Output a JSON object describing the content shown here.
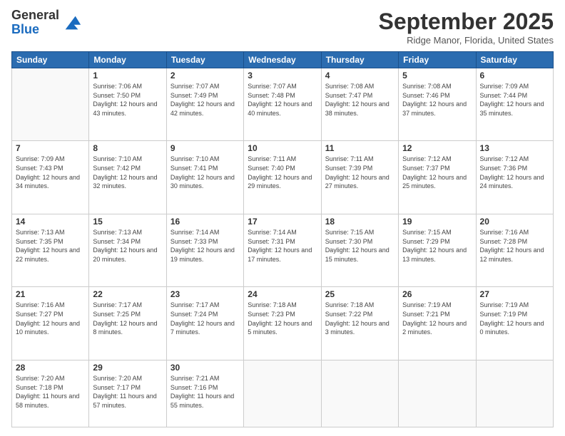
{
  "header": {
    "logo_general": "General",
    "logo_blue": "Blue",
    "month_title": "September 2025",
    "location": "Ridge Manor, Florida, United States"
  },
  "weekdays": [
    "Sunday",
    "Monday",
    "Tuesday",
    "Wednesday",
    "Thursday",
    "Friday",
    "Saturday"
  ],
  "weeks": [
    [
      {
        "day": "",
        "info": ""
      },
      {
        "day": "1",
        "info": "Sunrise: 7:06 AM\nSunset: 7:50 PM\nDaylight: 12 hours\nand 43 minutes."
      },
      {
        "day": "2",
        "info": "Sunrise: 7:07 AM\nSunset: 7:49 PM\nDaylight: 12 hours\nand 42 minutes."
      },
      {
        "day": "3",
        "info": "Sunrise: 7:07 AM\nSunset: 7:48 PM\nDaylight: 12 hours\nand 40 minutes."
      },
      {
        "day": "4",
        "info": "Sunrise: 7:08 AM\nSunset: 7:47 PM\nDaylight: 12 hours\nand 38 minutes."
      },
      {
        "day": "5",
        "info": "Sunrise: 7:08 AM\nSunset: 7:46 PM\nDaylight: 12 hours\nand 37 minutes."
      },
      {
        "day": "6",
        "info": "Sunrise: 7:09 AM\nSunset: 7:44 PM\nDaylight: 12 hours\nand 35 minutes."
      }
    ],
    [
      {
        "day": "7",
        "info": "Sunrise: 7:09 AM\nSunset: 7:43 PM\nDaylight: 12 hours\nand 34 minutes."
      },
      {
        "day": "8",
        "info": "Sunrise: 7:10 AM\nSunset: 7:42 PM\nDaylight: 12 hours\nand 32 minutes."
      },
      {
        "day": "9",
        "info": "Sunrise: 7:10 AM\nSunset: 7:41 PM\nDaylight: 12 hours\nand 30 minutes."
      },
      {
        "day": "10",
        "info": "Sunrise: 7:11 AM\nSunset: 7:40 PM\nDaylight: 12 hours\nand 29 minutes."
      },
      {
        "day": "11",
        "info": "Sunrise: 7:11 AM\nSunset: 7:39 PM\nDaylight: 12 hours\nand 27 minutes."
      },
      {
        "day": "12",
        "info": "Sunrise: 7:12 AM\nSunset: 7:37 PM\nDaylight: 12 hours\nand 25 minutes."
      },
      {
        "day": "13",
        "info": "Sunrise: 7:12 AM\nSunset: 7:36 PM\nDaylight: 12 hours\nand 24 minutes."
      }
    ],
    [
      {
        "day": "14",
        "info": "Sunrise: 7:13 AM\nSunset: 7:35 PM\nDaylight: 12 hours\nand 22 minutes."
      },
      {
        "day": "15",
        "info": "Sunrise: 7:13 AM\nSunset: 7:34 PM\nDaylight: 12 hours\nand 20 minutes."
      },
      {
        "day": "16",
        "info": "Sunrise: 7:14 AM\nSunset: 7:33 PM\nDaylight: 12 hours\nand 19 minutes."
      },
      {
        "day": "17",
        "info": "Sunrise: 7:14 AM\nSunset: 7:31 PM\nDaylight: 12 hours\nand 17 minutes."
      },
      {
        "day": "18",
        "info": "Sunrise: 7:15 AM\nSunset: 7:30 PM\nDaylight: 12 hours\nand 15 minutes."
      },
      {
        "day": "19",
        "info": "Sunrise: 7:15 AM\nSunset: 7:29 PM\nDaylight: 12 hours\nand 13 minutes."
      },
      {
        "day": "20",
        "info": "Sunrise: 7:16 AM\nSunset: 7:28 PM\nDaylight: 12 hours\nand 12 minutes."
      }
    ],
    [
      {
        "day": "21",
        "info": "Sunrise: 7:16 AM\nSunset: 7:27 PM\nDaylight: 12 hours\nand 10 minutes."
      },
      {
        "day": "22",
        "info": "Sunrise: 7:17 AM\nSunset: 7:25 PM\nDaylight: 12 hours\nand 8 minutes."
      },
      {
        "day": "23",
        "info": "Sunrise: 7:17 AM\nSunset: 7:24 PM\nDaylight: 12 hours\nand 7 minutes."
      },
      {
        "day": "24",
        "info": "Sunrise: 7:18 AM\nSunset: 7:23 PM\nDaylight: 12 hours\nand 5 minutes."
      },
      {
        "day": "25",
        "info": "Sunrise: 7:18 AM\nSunset: 7:22 PM\nDaylight: 12 hours\nand 3 minutes."
      },
      {
        "day": "26",
        "info": "Sunrise: 7:19 AM\nSunset: 7:21 PM\nDaylight: 12 hours\nand 2 minutes."
      },
      {
        "day": "27",
        "info": "Sunrise: 7:19 AM\nSunset: 7:19 PM\nDaylight: 12 hours\nand 0 minutes."
      }
    ],
    [
      {
        "day": "28",
        "info": "Sunrise: 7:20 AM\nSunset: 7:18 PM\nDaylight: 11 hours\nand 58 minutes."
      },
      {
        "day": "29",
        "info": "Sunrise: 7:20 AM\nSunset: 7:17 PM\nDaylight: 11 hours\nand 57 minutes."
      },
      {
        "day": "30",
        "info": "Sunrise: 7:21 AM\nSunset: 7:16 PM\nDaylight: 11 hours\nand 55 minutes."
      },
      {
        "day": "",
        "info": ""
      },
      {
        "day": "",
        "info": ""
      },
      {
        "day": "",
        "info": ""
      },
      {
        "day": "",
        "info": ""
      }
    ]
  ]
}
